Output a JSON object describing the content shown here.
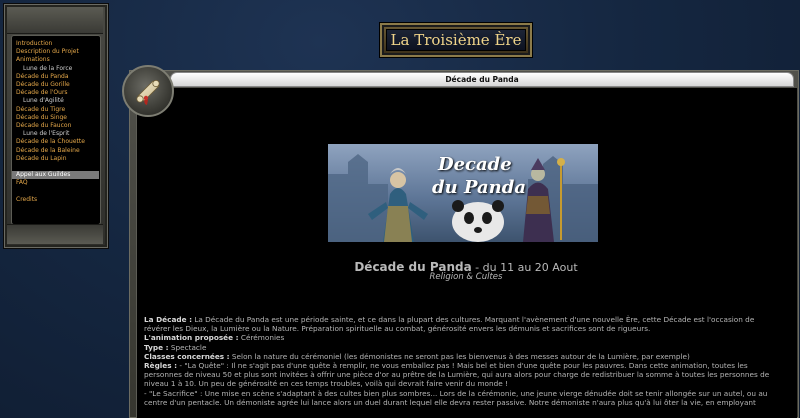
{
  "menu": {
    "items": [
      {
        "label": "Introduction",
        "type": "main"
      },
      {
        "label": "Description du Projet",
        "type": "main"
      },
      {
        "label": "Animations",
        "type": "main"
      },
      {
        "label": "Lune de la Force",
        "type": "sub"
      },
      {
        "label": "Décade du Panda",
        "type": "main"
      },
      {
        "label": "Décade du Gorille",
        "type": "main"
      },
      {
        "label": "Décade de l'Ours",
        "type": "main"
      },
      {
        "label": "Lune d'Agilité",
        "type": "sub"
      },
      {
        "label": "Décade du Tigre",
        "type": "main"
      },
      {
        "label": "Décade du Singe",
        "type": "main"
      },
      {
        "label": "Décade du Faucon",
        "type": "main"
      },
      {
        "label": "Lune de l'Esprit",
        "type": "sub"
      },
      {
        "label": "Décade de la Chouette",
        "type": "main"
      },
      {
        "label": "Décade de la Baleine",
        "type": "main"
      },
      {
        "label": "Décade du Lapin",
        "type": "main"
      },
      {
        "label": "Appel aux Guildes",
        "type": "highlight"
      },
      {
        "label": "FAQ",
        "type": "main"
      },
      {
        "label": "Credits",
        "type": "main"
      }
    ]
  },
  "site_title": "La Troisième Ère",
  "section_title": "Décade du Panda",
  "banner": {
    "line1": "Decade",
    "line2": "du Panda"
  },
  "headline": {
    "main": "Décade du Panda",
    "dates": " - du 11 au 20 Aout"
  },
  "subheadline": "Religion & Cultes",
  "body": {
    "decade_label": "La Décade :",
    "decade_text": " La Décade du Panda est une période sainte, et ce dans la plupart des cultures. Marquant l'avènement d'une nouvelle Ère, cette Décade est l'occasion de révérer les Dieux, la Lumière ou la Nature. Préparation spirituelle au combat, générosité envers les démunis et sacrifices sont de rigueurs.",
    "animation_label": "L'animation proposée :",
    "animation_text": " Cérémonies",
    "type_label": "Type :",
    "type_text": " Spectacle",
    "classes_label": "Classes concernées :",
    "classes_text": " Selon la nature du cérémoniel (les démonistes ne seront pas les bienvenus à des messes autour de la Lumière, par exemple)",
    "rules_label": "Règles :",
    "rules_text1": " - \"La Quête\" : Il ne s'agit pas d'une quête à remplir, ne vous emballez pas ! Mais bel et bien d'une quête pour les pauvres. Dans cette animation, toutes les personnes de niveau 50 et plus sont invitées à offrir une pièce d'or au prêtre de la Lumière, qui aura alors pour charge de redistribuer la somme à toutes les personnes de niveau 1 à 10. Un peu de générosité en ces temps troubles, voilà qui devrait faire venir du monde !",
    "rules_text2": "- \"Le Sacrifice\" : Une mise en scène s'adaptant à des cultes bien plus sombres... Lors de la cérémonie, une jeune vierge dénudée doit se tenir allongée sur un autel, ou au centre d'un pentacle. Un démoniste agrée lui lance alors un duel durant lequel elle devra rester passive. Notre démoniste n'aura plus qu'à lui ôter la vie, en employant"
  },
  "colors": {
    "menu_link": "#e5a84a",
    "menu_sub": "#cfcfcf",
    "title_gold": "#f0d48a",
    "page_bg": "#15243c"
  },
  "icons": {
    "badge": "scroll-icon"
  }
}
